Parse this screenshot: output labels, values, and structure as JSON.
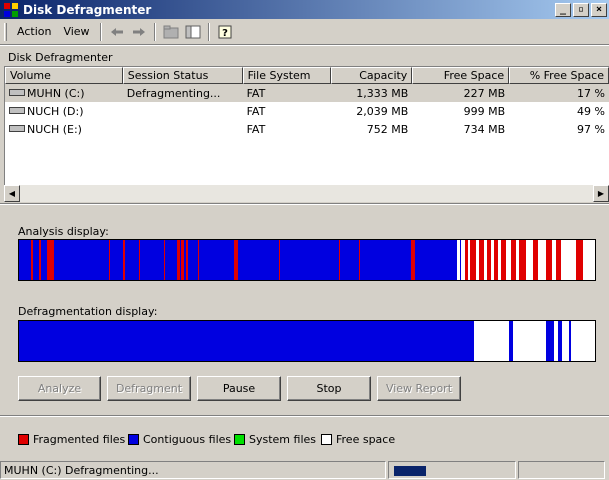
{
  "window": {
    "title": "Disk Defragmenter",
    "controls": {
      "minimize": "_",
      "maximize": "▫",
      "close": "×"
    }
  },
  "menu": {
    "action": "Action",
    "view": "View"
  },
  "breadcrumb": "Disk Defragmenter",
  "list": {
    "columns": [
      "Volume",
      "Session Status",
      "File System",
      "Capacity",
      "Free Space",
      "% Free Space"
    ],
    "rows": [
      {
        "volume": "MUHN (C:)",
        "status": "Defragmenting...",
        "fs": "FAT",
        "capacity": "1,333 MB",
        "free": "227 MB",
        "pct": "17 %"
      },
      {
        "volume": "NUCH (D:)",
        "status": "",
        "fs": "FAT",
        "capacity": "2,039 MB",
        "free": "999 MB",
        "pct": "49 %"
      },
      {
        "volume": "NUCH (E:)",
        "status": "",
        "fs": "FAT",
        "capacity": "752 MB",
        "free": "734 MB",
        "pct": "97 %"
      }
    ]
  },
  "analysis_label": "Analysis display:",
  "defrag_label": "Defragmentation display:",
  "buttons": {
    "analyze": "Analyze",
    "defragment": "Defragment",
    "pause": "Pause",
    "stop": "Stop",
    "view_report": "View Report"
  },
  "legend": {
    "fragmented": "Fragmented files",
    "contiguous": "Contiguous files",
    "system": "System files",
    "free": "Free space"
  },
  "colors": {
    "fragmented": "#e00000",
    "contiguous": "#0000e0",
    "system": "#00e000",
    "free": "#ffffff"
  },
  "status": {
    "text": "MUHN (C:) Defragmenting...",
    "progress": 1.0
  }
}
